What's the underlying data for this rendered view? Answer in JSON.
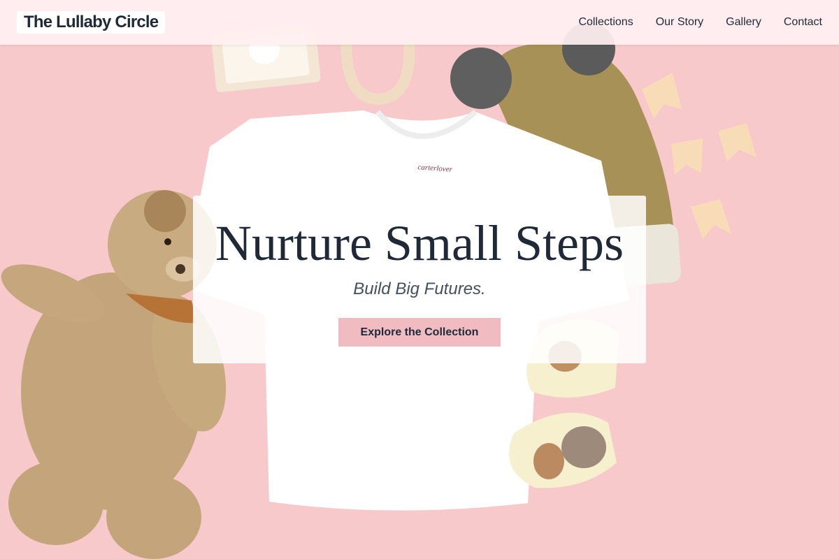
{
  "header": {
    "brand": "The Lullaby Circle",
    "nav": [
      {
        "label": "Collections"
      },
      {
        "label": "Our Story"
      },
      {
        "label": "Gallery"
      },
      {
        "label": "Contact"
      }
    ]
  },
  "hero": {
    "title": "Nurture Small Steps",
    "subtitle": "Build Big Futures.",
    "cta_label": "Explore the Collection",
    "tshirt_tag": "carterlover"
  },
  "colors": {
    "background": "#f7c9cb",
    "nav_background": "#fff0f1",
    "text_dark": "#1f2937",
    "subtitle": "#44505f",
    "cta": "#f0bcc1"
  },
  "icons": [
    "teddy-bear-icon",
    "baby-tshirt-icon",
    "knit-beanie-icon",
    "baby-socks-icon",
    "bunting-flag-icon",
    "headband-icon",
    "gift-box-icon"
  ]
}
